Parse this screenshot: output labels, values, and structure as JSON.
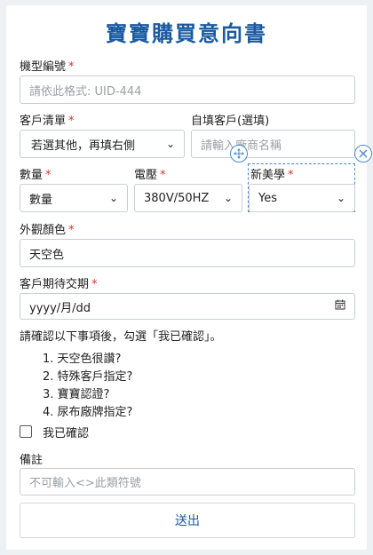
{
  "title": "寶寶購買意向書",
  "required_mark": "*",
  "model": {
    "label": "機型編號",
    "placeholder": "請依此格式: UID-444"
  },
  "customer_list": {
    "label": "客戶清單",
    "value": "若選其他，再填右側"
  },
  "custom_customer": {
    "label": "自填客戶(選填)",
    "placeholder": "請輸入廠商名稱"
  },
  "quantity": {
    "label": "數量",
    "value": "數量"
  },
  "voltage": {
    "label": "電壓",
    "value": "380V/50HZ"
  },
  "new_learner": {
    "label": "新美學",
    "value": "Yes"
  },
  "color": {
    "label": "外觀顏色",
    "value": "天空色"
  },
  "delivery": {
    "label": "客戶期待交期",
    "placeholder": "yyyy/月/dd"
  },
  "confirm_prompt": "請確認以下事項後，勾選「我已確認」。",
  "confirm_items": [
    "1. 天空色很讚?",
    "2. 特殊客戶指定?",
    "3. 寶寶認證?",
    "4. 尿布廠牌指定?"
  ],
  "confirm_label": "我已確認",
  "notes": {
    "label": "備註",
    "placeholder": "不可輸入<>此類符號"
  },
  "submit_label": "送出"
}
